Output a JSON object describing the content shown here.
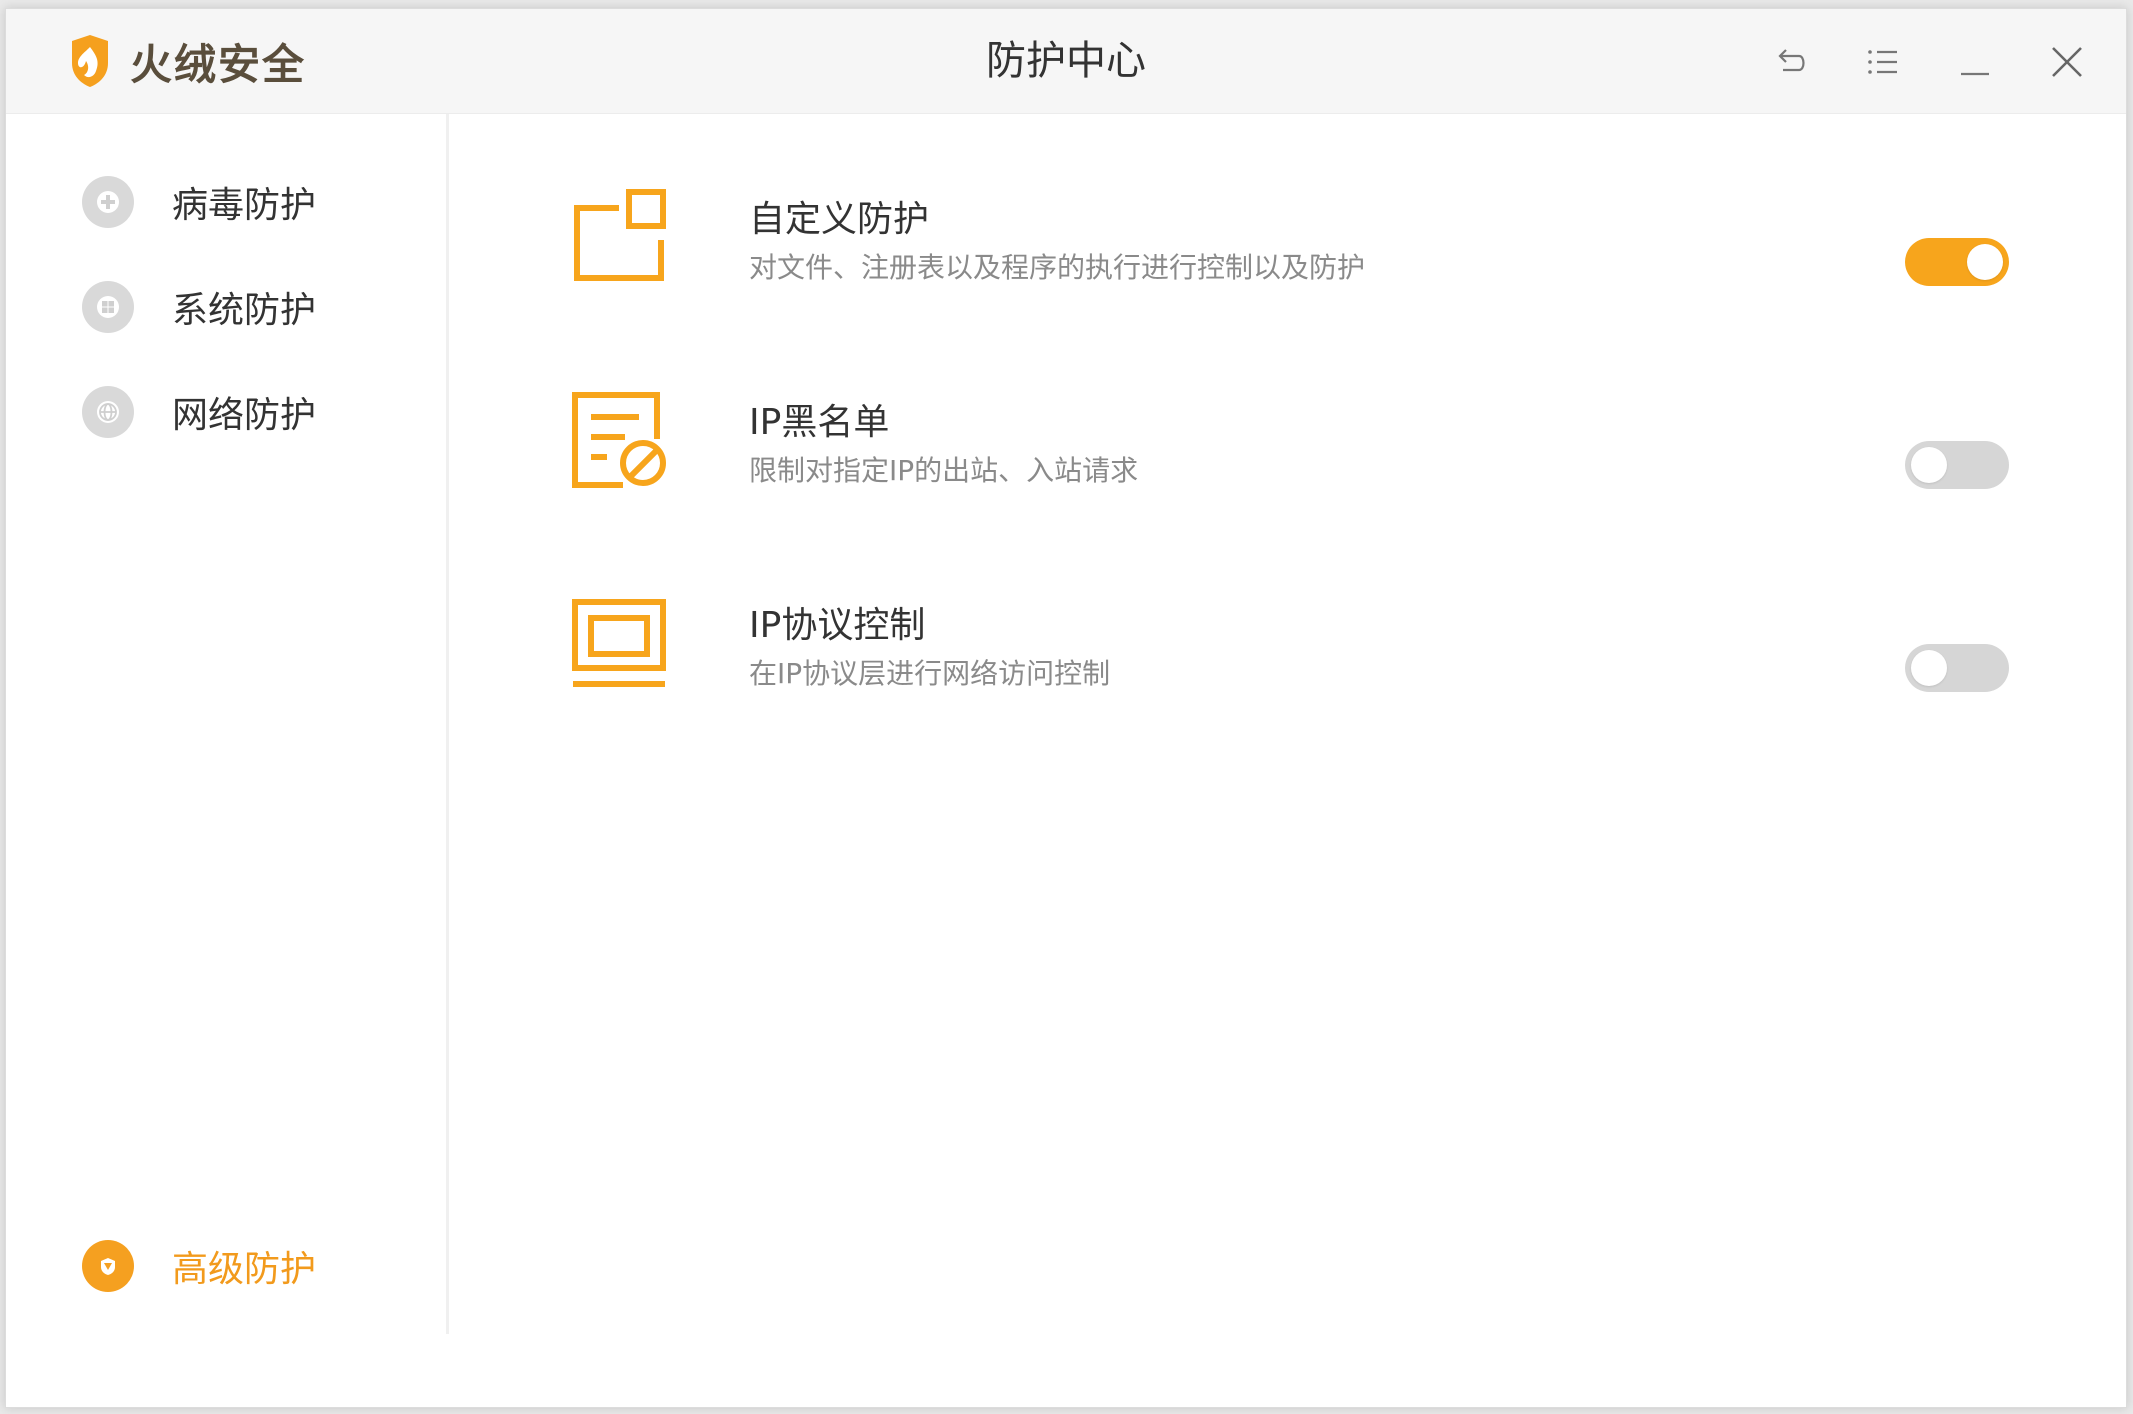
{
  "app": {
    "brand_name": "火绒安全",
    "window_title": "防护中心"
  },
  "title_controls": [
    {
      "name": "back-icon"
    },
    {
      "name": "menu-icon"
    },
    {
      "name": "minimize-icon"
    },
    {
      "name": "close-icon"
    }
  ],
  "sidebar": {
    "items": [
      {
        "label": "病毒防护",
        "icon": "virus-protection-icon"
      },
      {
        "label": "系统防护",
        "icon": "system-protection-icon"
      },
      {
        "label": "网络防护",
        "icon": "network-protection-icon"
      }
    ],
    "premium": {
      "label": "高级防护",
      "icon": "premium-shield-icon"
    }
  },
  "features": [
    {
      "title": "自定义防护",
      "desc": "对文件、注册表以及程序的执行进行控制以及防护",
      "enabled": true,
      "icon": "custom-protection-icon"
    },
    {
      "title": "IP黑名单",
      "desc": "限制对指定IP的出站、入站请求",
      "enabled": false,
      "icon": "ip-blacklist-icon"
    },
    {
      "title": "IP协议控制",
      "desc": "在IP协议层进行网络访问控制",
      "enabled": false,
      "icon": "ip-protocol-icon"
    }
  ],
  "colors": {
    "accent": "#f7a51c",
    "toggle_off": "#d6d6d6",
    "text_primary": "#333333",
    "text_secondary": "#8a8a8a"
  }
}
